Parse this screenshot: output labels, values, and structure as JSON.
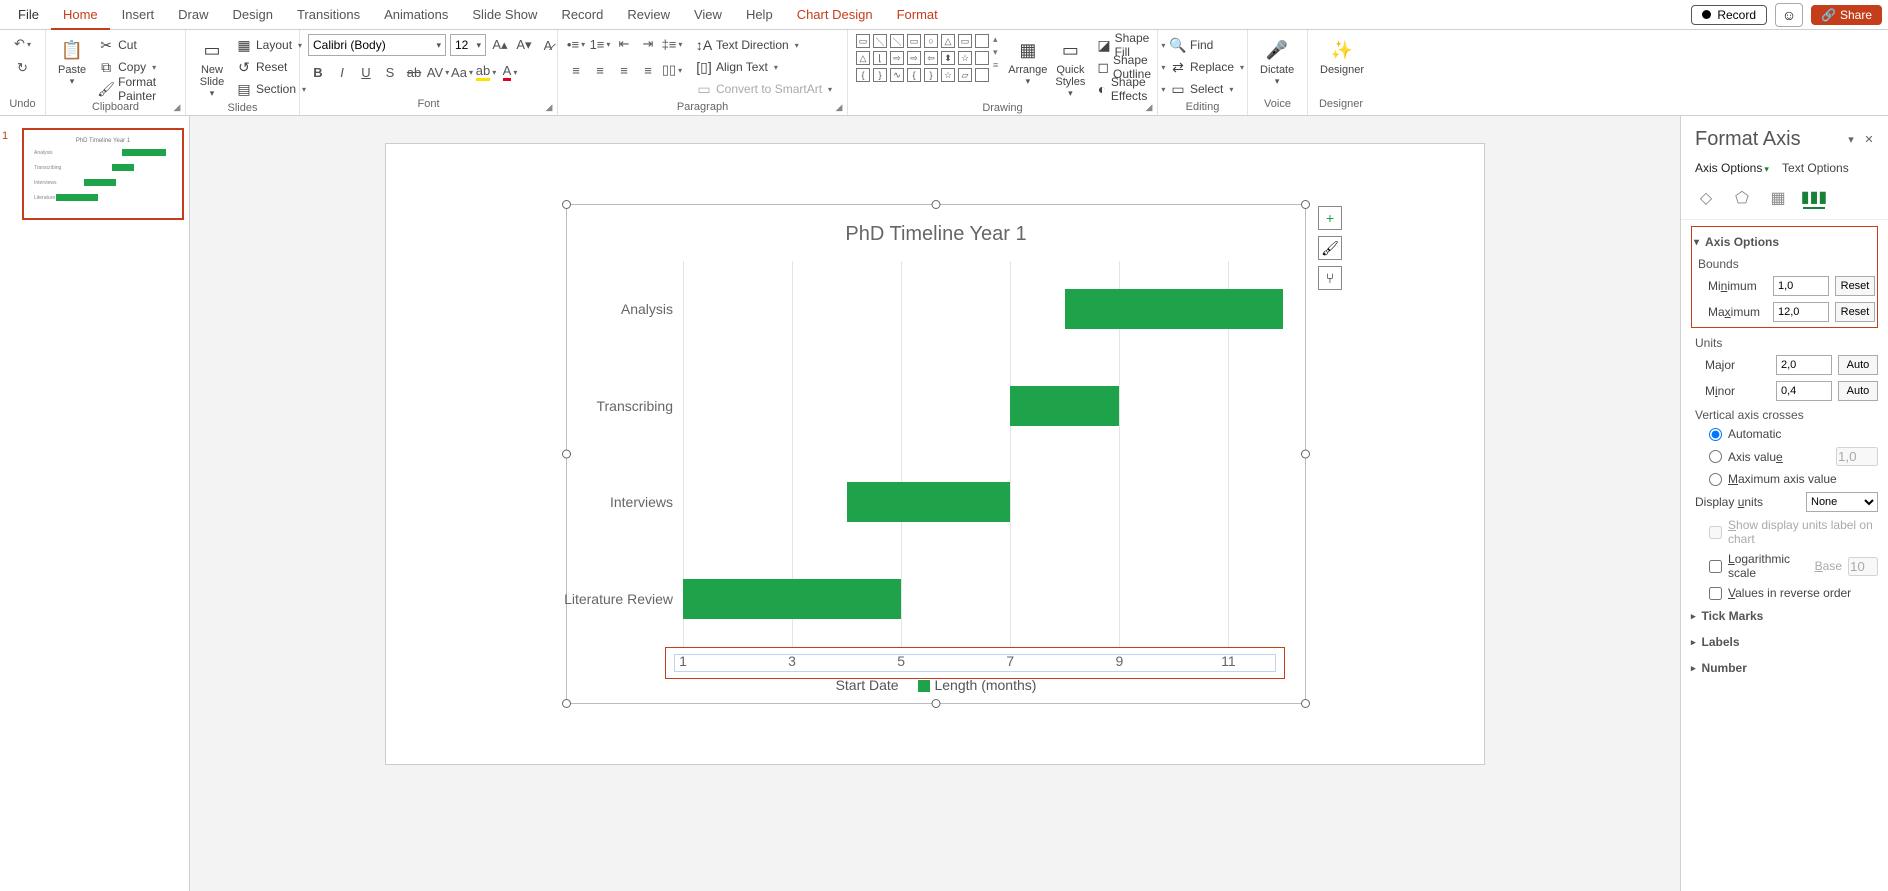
{
  "tabs": {
    "file": "File",
    "home": "Home",
    "insert": "Insert",
    "draw": "Draw",
    "design": "Design",
    "transitions": "Transitions",
    "animations": "Animations",
    "slideshow": "Slide Show",
    "record": "Record",
    "review": "Review",
    "view": "View",
    "help": "Help",
    "chartdesign": "Chart Design",
    "format": "Format"
  },
  "topright": {
    "record": "Record",
    "share": "Share"
  },
  "ribbon": {
    "undo": "Undo",
    "clipboard": {
      "paste": "Paste",
      "cut": "Cut",
      "copy": "Copy",
      "painter": "Format Painter",
      "label": "Clipboard"
    },
    "slides": {
      "new": "New\nSlide",
      "layout": "Layout",
      "reset": "Reset",
      "section": "Section",
      "label": "Slides"
    },
    "font": {
      "name": "Calibri (Body)",
      "size": "12",
      "label": "Font"
    },
    "paragraph": {
      "textdir": "Text Direction",
      "align": "Align Text",
      "smartart": "Convert to SmartArt",
      "label": "Paragraph"
    },
    "drawing": {
      "arrange": "Arrange",
      "quick": "Quick\nStyles",
      "fill": "Shape Fill",
      "outline": "Shape Outline",
      "effects": "Shape Effects",
      "label": "Drawing"
    },
    "editing": {
      "find": "Find",
      "replace": "Replace",
      "select": "Select",
      "label": "Editing"
    },
    "voice": {
      "dictate": "Dictate",
      "label": "Voice"
    },
    "designer": {
      "designer": "Designer",
      "label": "Designer"
    }
  },
  "slide_number": "1",
  "chart_data": {
    "type": "bar",
    "orientation": "horizontal",
    "title": "PhD Timeline Year 1",
    "xlabel": "",
    "ylabel": "",
    "xlim": [
      1,
      12
    ],
    "xticks": [
      1,
      3,
      5,
      7,
      9,
      11
    ],
    "categories": [
      "Analysis",
      "Transcribing",
      "Interviews",
      "Literature Review"
    ],
    "series": [
      {
        "name": "Start Date",
        "values": [
          8,
          7,
          4,
          1
        ],
        "color": "transparent"
      },
      {
        "name": "Length (months)",
        "values": [
          4,
          2,
          3,
          4
        ],
        "color": "#1fa34a"
      }
    ],
    "legend_position": "bottom"
  },
  "sidechart": {
    "plus": "+",
    "brush": "🖌",
    "filter": "⑂"
  },
  "pane": {
    "title": "Format Axis",
    "tab_axis": "Axis Options",
    "tab_text": "Text Options",
    "sect_axis": "Axis Options",
    "bounds": "Bounds",
    "min": "Minimum",
    "min_v": "1,0",
    "max": "Maximum",
    "max_v": "12,0",
    "reset": "Reset",
    "units": "Units",
    "major": "Major",
    "major_v": "2,0",
    "minor": "Minor",
    "minor_v": "0,4",
    "auto": "Auto",
    "cross": "Vertical axis crosses",
    "cr_auto": "Automatic",
    "cr_val": "Axis value",
    "cr_val_v": "1,0",
    "cr_max": "Maximum axis value",
    "dispunits": "Display units",
    "dispunits_v": "None",
    "show_du": "Show display units label on chart",
    "log": "Logarithmic scale",
    "base": "Base",
    "base_v": "10",
    "rev": "Values in reverse order",
    "tick": "Tick Marks",
    "labels": "Labels",
    "number": "Number"
  }
}
